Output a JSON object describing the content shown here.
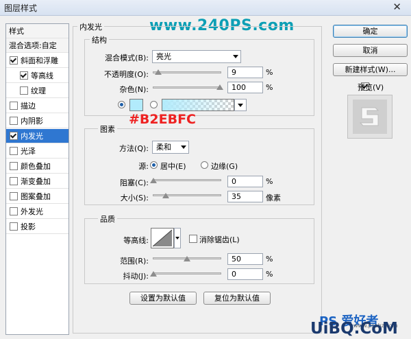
{
  "window": {
    "title": "图层样式"
  },
  "watermark_top": "www.240PS.com",
  "styles_list": [
    {
      "label": "样式",
      "type": "header"
    },
    {
      "label": "混合选项:自定",
      "type": "header"
    },
    {
      "label": "斜面和浮雕",
      "checked": true
    },
    {
      "label": "等高线",
      "checked": true,
      "indent": true
    },
    {
      "label": "纹理",
      "checked": false,
      "indent": true
    },
    {
      "label": "描边",
      "checked": false
    },
    {
      "label": "内阴影",
      "checked": false
    },
    {
      "label": "内发光",
      "checked": true,
      "selected": true
    },
    {
      "label": "光泽",
      "checked": false
    },
    {
      "label": "颜色叠加",
      "checked": false
    },
    {
      "label": "渐变叠加",
      "checked": false
    },
    {
      "label": "图案叠加",
      "checked": false
    },
    {
      "label": "外发光",
      "checked": false
    },
    {
      "label": "投影",
      "checked": false
    }
  ],
  "panel_title": "内发光",
  "structure": {
    "title": "结构",
    "blend_mode_label": "混合模式(B):",
    "blend_mode_value": "亮光",
    "opacity_label": "不透明度(O):",
    "opacity_value": "9",
    "opacity_unit": "%",
    "noise_label": "杂色(N):",
    "noise_value": "100",
    "noise_unit": "%",
    "glow_color": "#B2EBFC"
  },
  "color_annotation": "#B2EBFC",
  "elements": {
    "title": "图素",
    "technique_label": "方法(Q):",
    "technique_value": "柔和",
    "source_label": "源:",
    "source_center": "居中(E)",
    "source_edge": "边缘(G)",
    "choke_label": "阻塞(C):",
    "choke_value": "0",
    "choke_unit": "%",
    "size_label": "大小(S):",
    "size_value": "35",
    "size_unit": "像素"
  },
  "quality": {
    "title": "品质",
    "contour_label": "等高线:",
    "antialias_label": "消除锯齿(L)",
    "range_label": "范围(R):",
    "range_value": "50",
    "range_unit": "%",
    "jitter_label": "抖动(J):",
    "jitter_value": "0",
    "jitter_unit": "%"
  },
  "bottom_buttons": {
    "set_default": "设置为默认值",
    "reset_default": "复位为默认值"
  },
  "right_buttons": {
    "ok": "确定",
    "cancel": "取消",
    "new_style": "新建样式(W)...",
    "preview": "预览(V)"
  },
  "watermark_bottom": {
    "brand": "UiBQ.CoM",
    "ps": "PS 爱好者",
    "small": "www.psahz.com"
  }
}
